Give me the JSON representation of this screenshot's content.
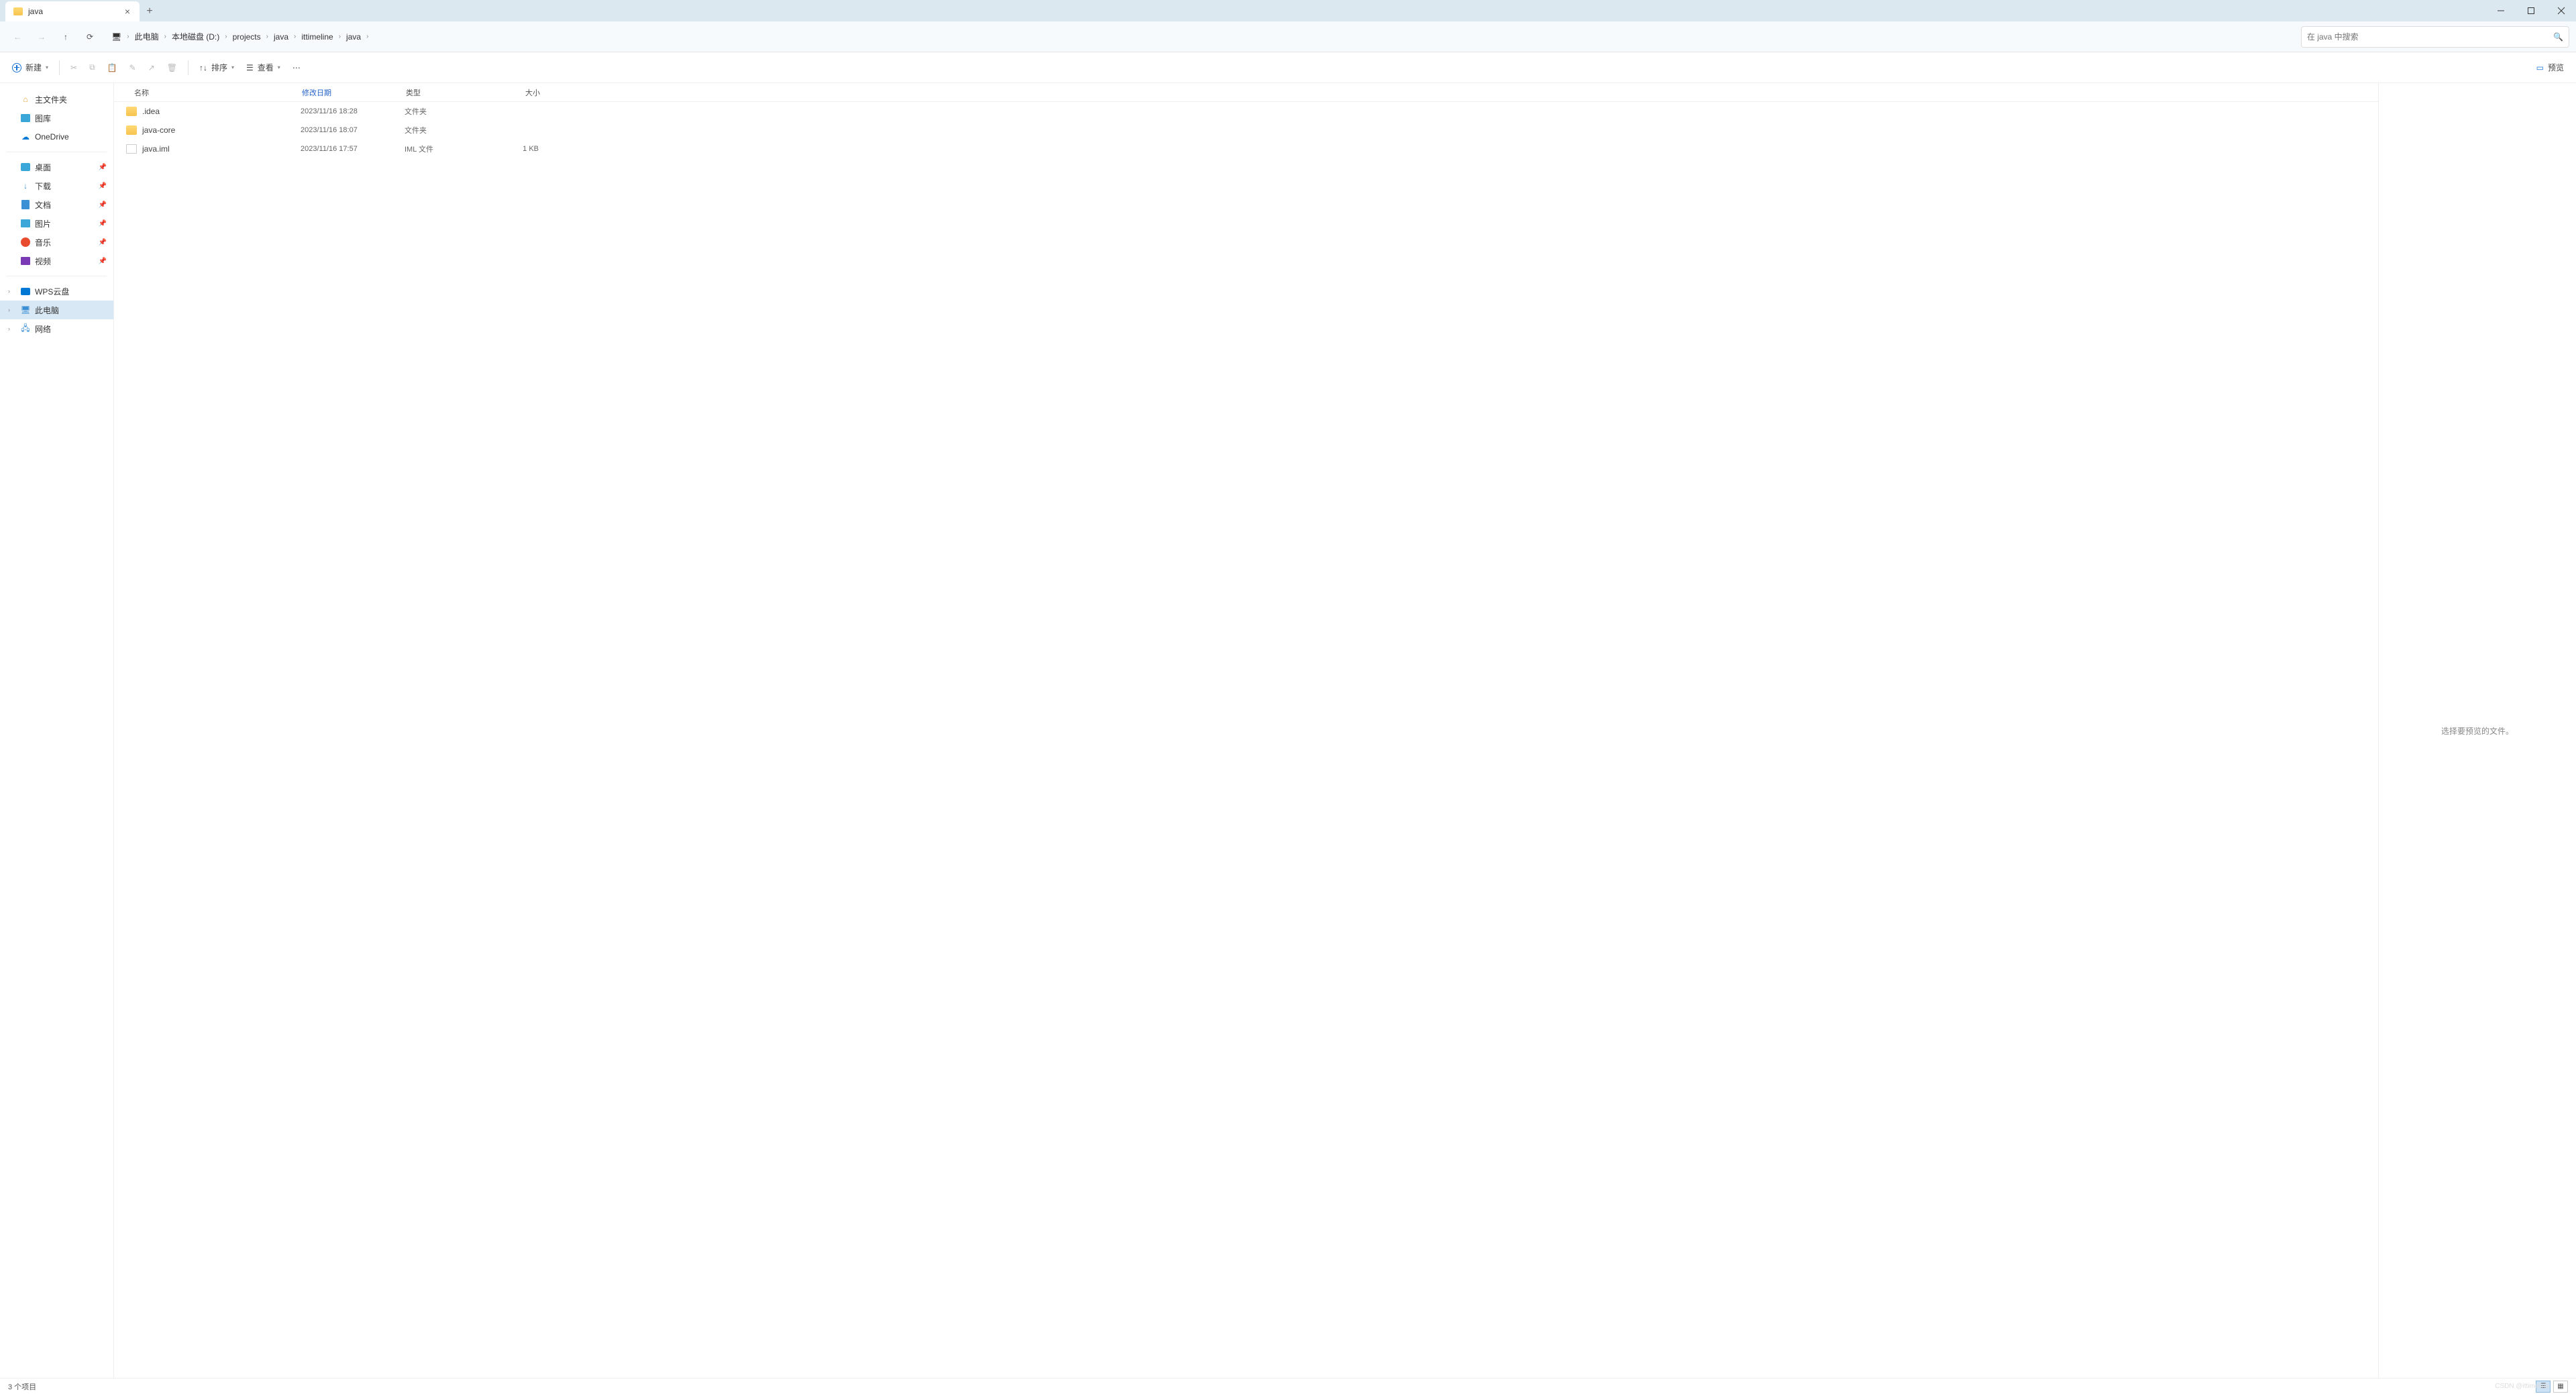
{
  "tab": {
    "title": "java"
  },
  "breadcrumb": [
    "此电脑",
    "本地磁盘 (D:)",
    "projects",
    "java",
    "ittimeline",
    "java"
  ],
  "search": {
    "placeholder": "在 java 中搜索"
  },
  "toolbar": {
    "new": "新建",
    "sort": "排序",
    "view": "查看",
    "preview": "预览"
  },
  "sidebar": {
    "home": "主文件夹",
    "gallery": "图库",
    "onedrive": "OneDrive",
    "desktop": "桌面",
    "downloads": "下载",
    "documents": "文档",
    "pictures": "图片",
    "music": "音乐",
    "videos": "视频",
    "wps": "WPS云盘",
    "thispc": "此电脑",
    "network": "网络"
  },
  "columns": {
    "name": "名称",
    "date": "修改日期",
    "type": "类型",
    "size": "大小"
  },
  "files": [
    {
      "name": ".idea",
      "date": "2023/11/16 18:28",
      "type": "文件夹",
      "size": "",
      "icon": "folder"
    },
    {
      "name": "java-core",
      "date": "2023/11/16 18:07",
      "type": "文件夹",
      "size": "",
      "icon": "folder"
    },
    {
      "name": "java.iml",
      "date": "2023/11/16 17:57",
      "type": "IML 文件",
      "size": "1 KB",
      "icon": "file"
    }
  ],
  "preview_hint": "选择要预览的文件。",
  "status": {
    "count": "3 个项目"
  },
  "watermark": "CSDN @ittimeline"
}
